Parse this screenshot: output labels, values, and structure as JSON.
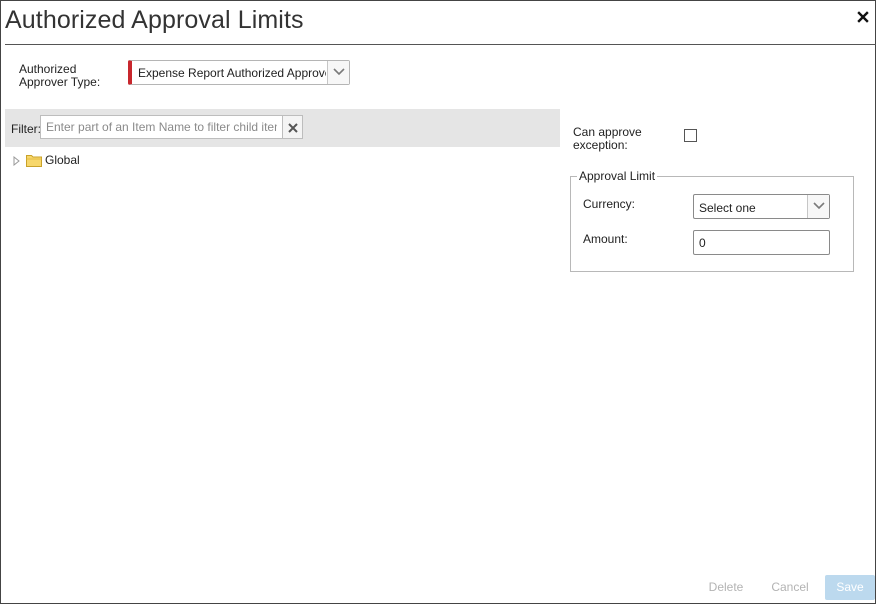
{
  "dialog": {
    "title": "Authorized Approval Limits",
    "close_symbol": "✕"
  },
  "approver_type": {
    "label_line1": "Authorized",
    "label_line2": "Approver Type:",
    "selected": "Expense Report Authorized Approver"
  },
  "filter": {
    "label": "Filter:",
    "placeholder": "Enter part of an Item Name to filter child items",
    "value": ""
  },
  "tree": {
    "items": [
      {
        "label": "Global",
        "icon": "folder-icon",
        "expanded": false
      }
    ]
  },
  "exception": {
    "label_line1": "Can approve",
    "label_line2": "exception:",
    "checked": false
  },
  "approval_limit": {
    "legend": "Approval Limit",
    "currency_label": "Currency:",
    "currency_value": "Select one",
    "amount_label": "Amount:",
    "amount_value": "0"
  },
  "footer": {
    "delete_label": "Delete",
    "cancel_label": "Cancel",
    "save_label": "Save"
  },
  "colors": {
    "required_marker": "#c8272d",
    "filter_bar": "#e5e5e5",
    "save_button_disabled": "#bcd9ee",
    "disabled_text": "#b3b3b3"
  }
}
